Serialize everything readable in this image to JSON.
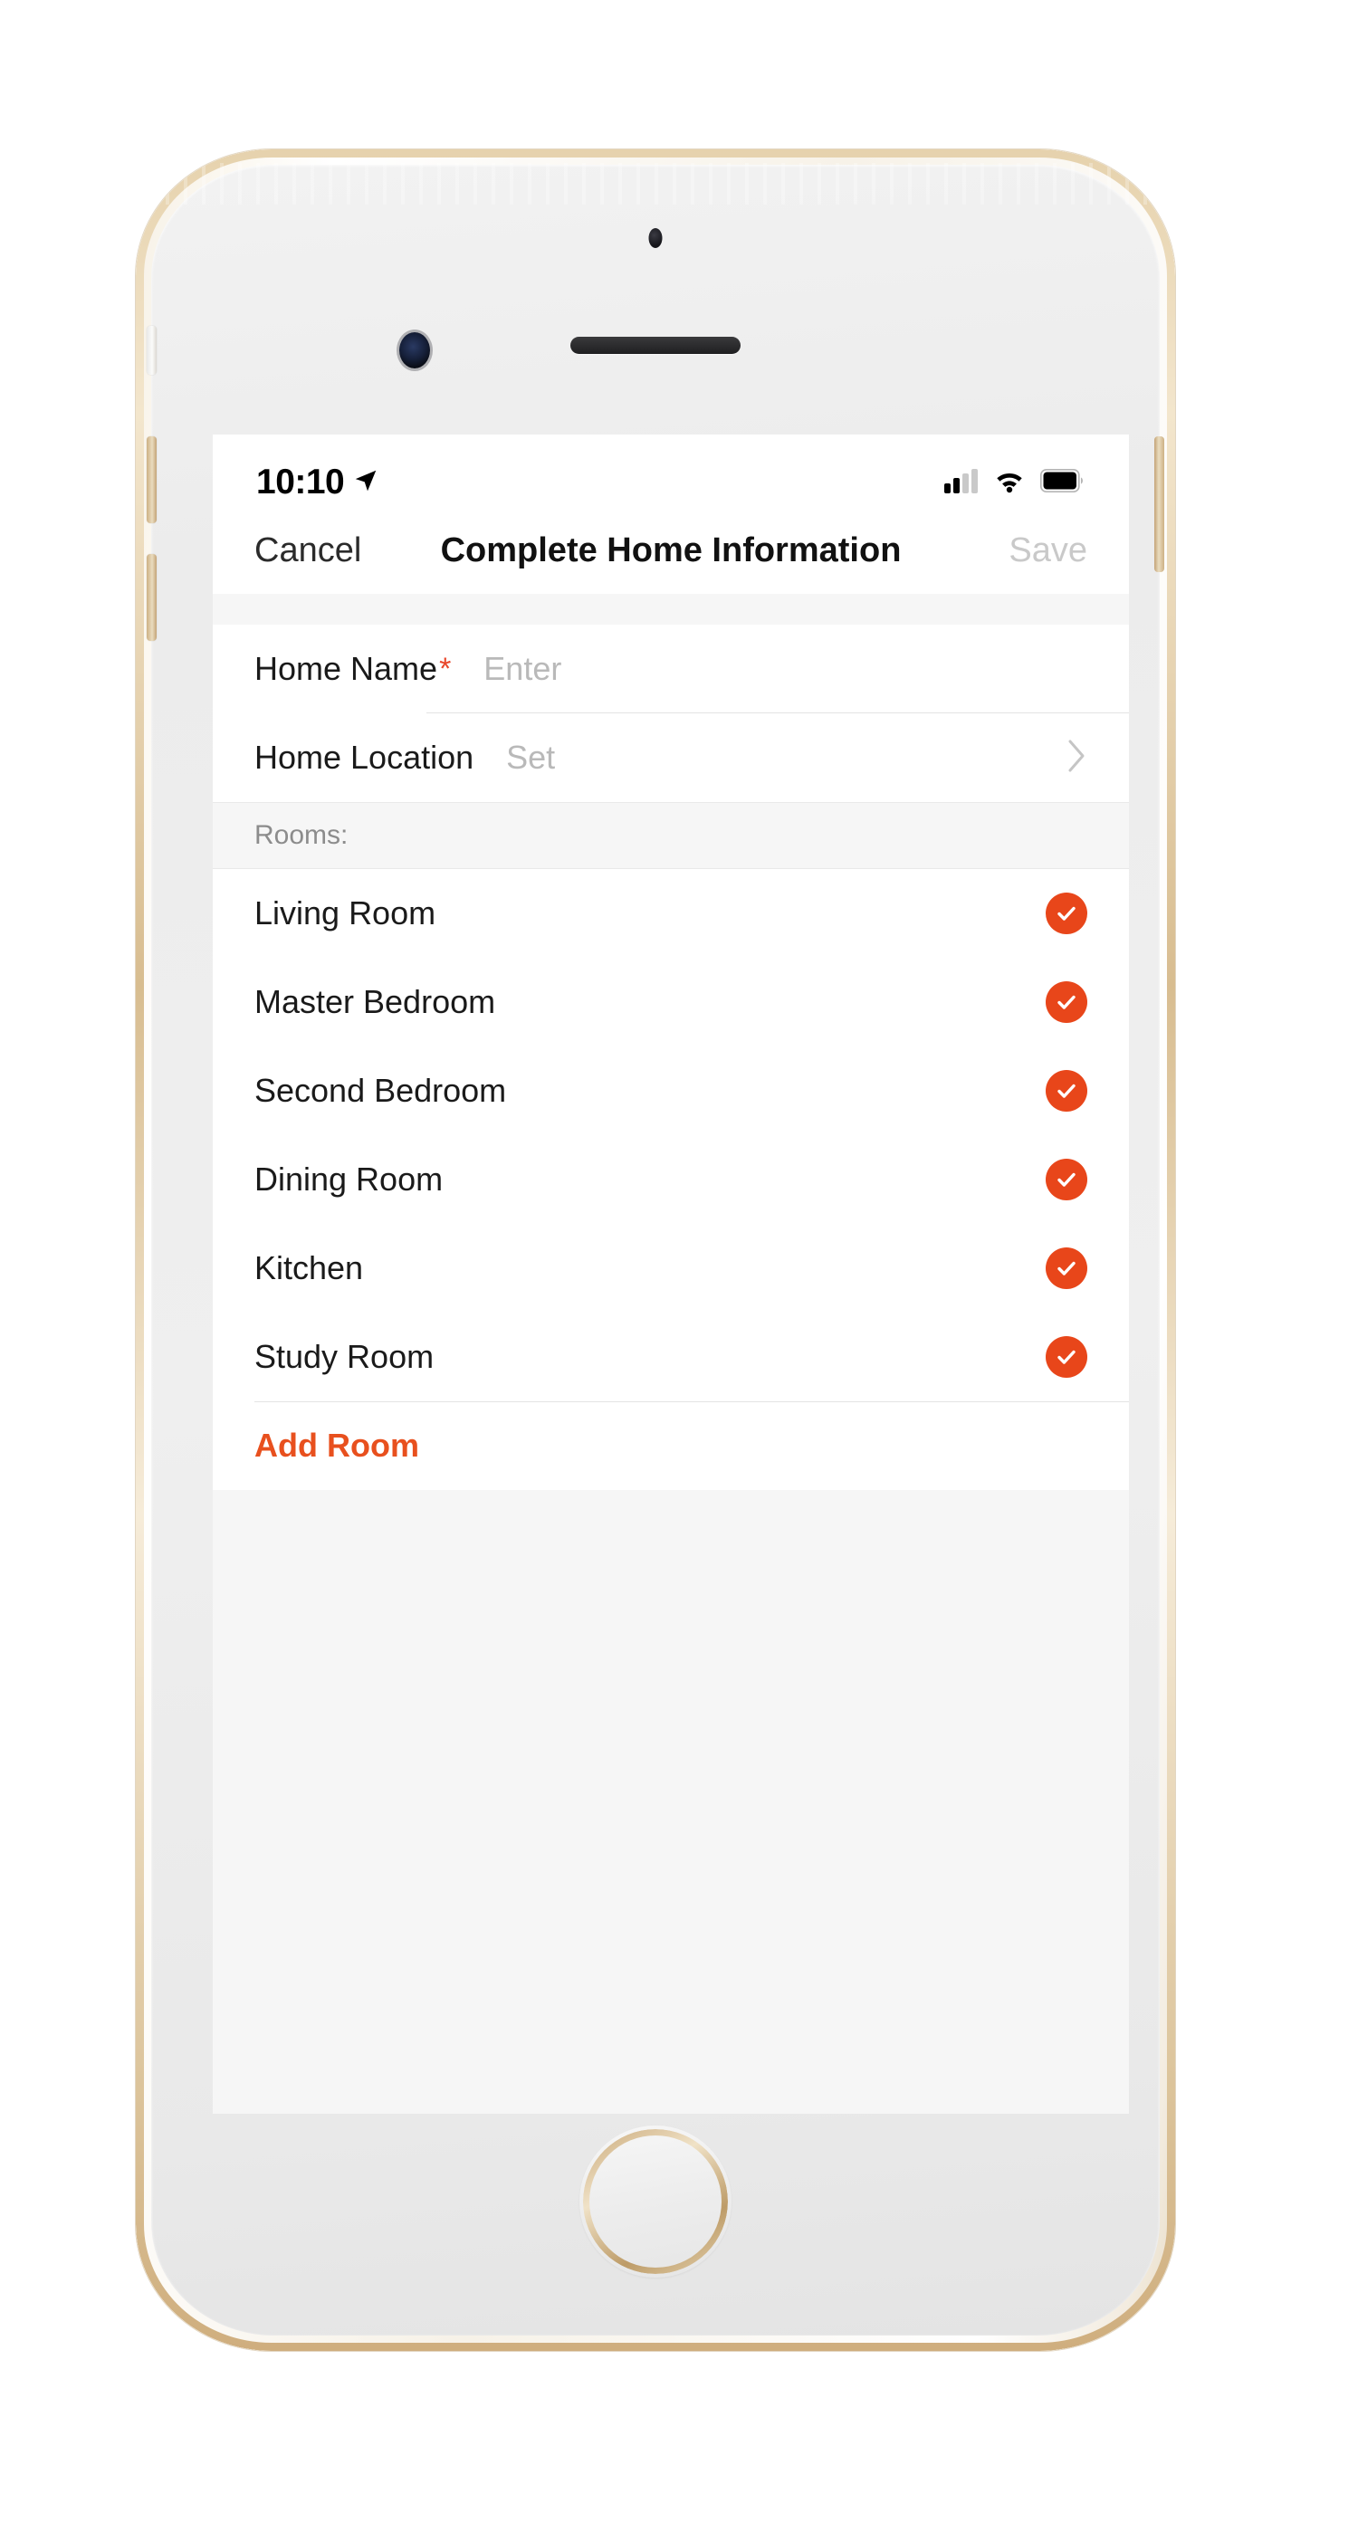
{
  "status_bar": {
    "time": "10:10",
    "location_icon": "location-arrow-icon",
    "signal_icon": "cellular-signal-icon",
    "wifi_icon": "wifi-icon",
    "battery_icon": "battery-full-icon"
  },
  "nav_bar": {
    "cancel_label": "Cancel",
    "title": "Complete Home Information",
    "save_label": "Save"
  },
  "form": {
    "home_name": {
      "label": "Home Name",
      "required_marker": "*",
      "value": "",
      "placeholder": "Enter"
    },
    "home_location": {
      "label": "Home Location",
      "value": "",
      "placeholder": "Set",
      "disclosure_icon": "chevron-right-icon"
    }
  },
  "rooms_section": {
    "header": "Rooms:",
    "items": [
      {
        "label": "Living Room",
        "selected": true,
        "icon": "check-circle-icon"
      },
      {
        "label": "Master Bedroom",
        "selected": true,
        "icon": "check-circle-icon"
      },
      {
        "label": "Second Bedroom",
        "selected": true,
        "icon": "check-circle-icon"
      },
      {
        "label": "Dining Room",
        "selected": true,
        "icon": "check-circle-icon"
      },
      {
        "label": "Kitchen",
        "selected": true,
        "icon": "check-circle-icon"
      },
      {
        "label": "Study Room",
        "selected": true,
        "icon": "check-circle-icon"
      }
    ],
    "add_room_label": "Add Room"
  },
  "device": {
    "body_color": "#e8dcc6",
    "front_color": "#ededed",
    "home_button_ring": "#c9a878"
  },
  "colors": {
    "accent": "#e8461a",
    "add_room": "#e8501e",
    "required_star": "#e8462a",
    "placeholder": "#b9b9b9",
    "disabled_text": "#c9c9c9",
    "label_text": "#1a1a1a",
    "section_header_text": "#8c8c8c",
    "screen_background": "#f6f6f6",
    "card_background": "#ffffff"
  }
}
